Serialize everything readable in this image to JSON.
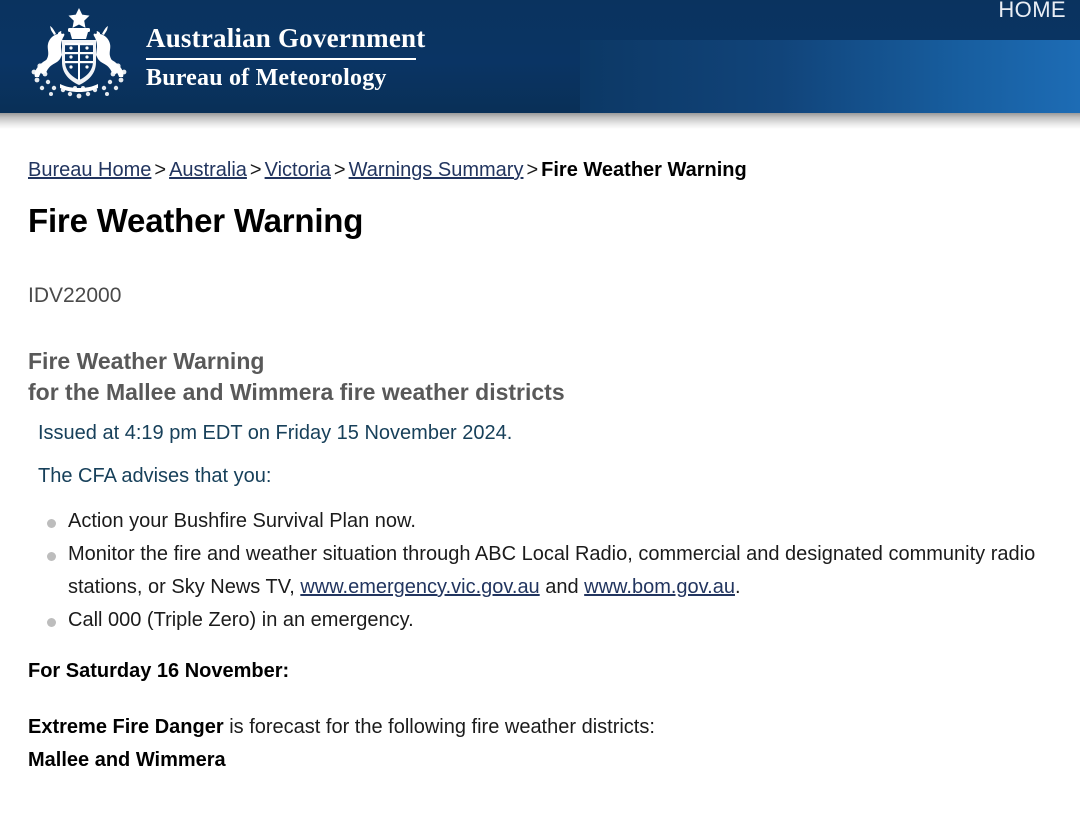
{
  "header": {
    "home_label": "HOME",
    "org_line1": "Australian Government",
    "org_line2": "Bureau of Meteorology",
    "crest_icon": "australian-coat-of-arms",
    "colors": {
      "header_navy": "#0a3464",
      "band_blue": "#1d6cb5",
      "link_navy": "#22355f"
    }
  },
  "breadcrumb": {
    "items": [
      {
        "label": "Bureau Home",
        "link": true
      },
      {
        "label": "Australia",
        "link": true
      },
      {
        "label": "Victoria",
        "link": true
      },
      {
        "label": "Warnings Summary",
        "link": true
      },
      {
        "label": "Fire Weather Warning",
        "link": false
      }
    ],
    "separator": ">"
  },
  "page": {
    "title": "Fire Weather Warning",
    "product_id": "IDV22000",
    "warning_heading_line1": "Fire Weather Warning",
    "warning_heading_line2": "for the Mallee and Wimmera fire weather districts",
    "issued": "Issued at 4:19 pm EDT on Friday 15 November 2024.",
    "advises_intro": "The CFA advises that you:",
    "advice": [
      {
        "text": "Action your Bushfire Survival Plan now."
      },
      {
        "pre": "Monitor the fire and weather situation through ABC Local Radio, commercial and designated community radio stations, or Sky News TV, ",
        "link1": "www.emergency.vic.gov.au",
        "mid": " and ",
        "link2": "www.bom.gov.au",
        "post": "."
      },
      {
        "text": "Call 000 (Triple Zero) in an emergency."
      }
    ],
    "for_day": "For Saturday 16 November:",
    "danger_level": "Extreme Fire Danger",
    "danger_rest": " is forecast for the following fire weather districts:",
    "districts": "Mallee and Wimmera"
  }
}
